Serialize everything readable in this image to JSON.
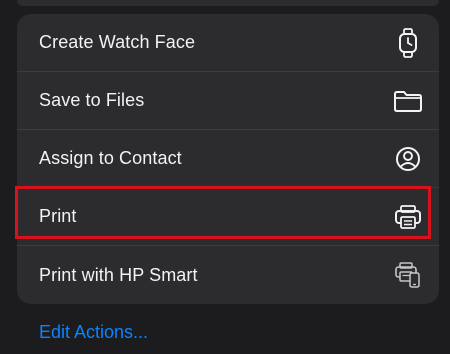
{
  "menu": {
    "items": [
      {
        "label": "Create Watch Face",
        "icon": "watch-icon"
      },
      {
        "label": "Save to Files",
        "icon": "folder-icon"
      },
      {
        "label": "Assign to Contact",
        "icon": "person-circle-icon"
      },
      {
        "label": "Print",
        "icon": "printer-icon"
      },
      {
        "label": "Print with HP Smart",
        "icon": "hp-smart-printer-icon"
      }
    ]
  },
  "footer": {
    "edit_actions_label": "Edit Actions..."
  },
  "colors": {
    "background": "#1c1c1e",
    "menu_background": "#2c2c2e",
    "text": "#f2f2f7",
    "accent_link": "#0a84ff",
    "highlight_border": "#d8121c"
  }
}
